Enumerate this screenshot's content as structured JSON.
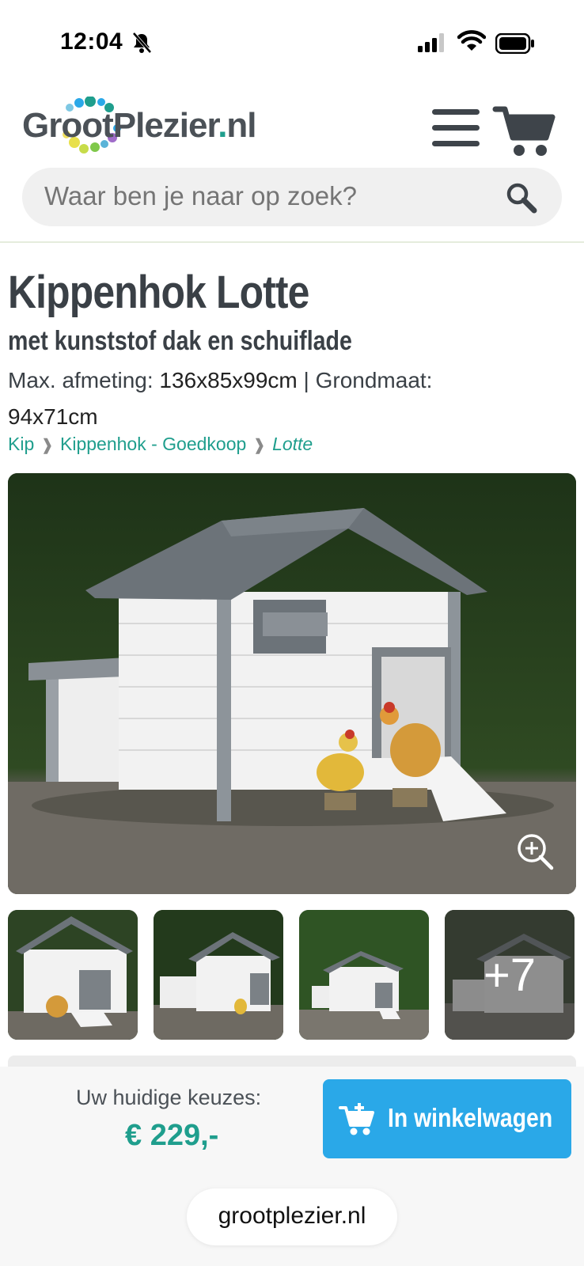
{
  "status_bar": {
    "time": "12:04",
    "icons": [
      "bell-slash-icon",
      "cellular-signal-icon",
      "wifi-icon",
      "battery-icon"
    ]
  },
  "header": {
    "logo_text_main": "GrootPlezier",
    "logo_text_dot": ".",
    "logo_text_tld": "nl",
    "menu_icon": "hamburger-menu-icon",
    "cart_icon": "shopping-cart-icon"
  },
  "search": {
    "placeholder": "Waar ben je naar op zoek?",
    "icon": "search-icon"
  },
  "product": {
    "title": "Kippenhok Lotte",
    "subtitle": "met kunststof dak en schuiflade",
    "dims_label_1": "Max. afmeting:",
    "dims_value_1": "136x85x99cm",
    "dims_separator": "|",
    "dims_label_2": "Grondmaat:",
    "dims_value_2": "94x71cm"
  },
  "breadcrumb": [
    {
      "label": "Kip"
    },
    {
      "label": "Kippenhok - Goedkoop"
    },
    {
      "label": "Lotte"
    }
  ],
  "breadcrumb_separator": "❱",
  "gallery": {
    "zoom_icon": "zoom-in-icon",
    "more_count": "+7"
  },
  "purchase": {
    "choice_label": "Uw huidige keuzes:",
    "price": "€ 229,-",
    "button_label": "In winkelwagen"
  },
  "browser": {
    "url": "grootplezier.nl"
  },
  "colors": {
    "brand_teal": "#1f9e8d",
    "button_blue": "#2aa8e8",
    "text_dark": "#3a4046"
  }
}
